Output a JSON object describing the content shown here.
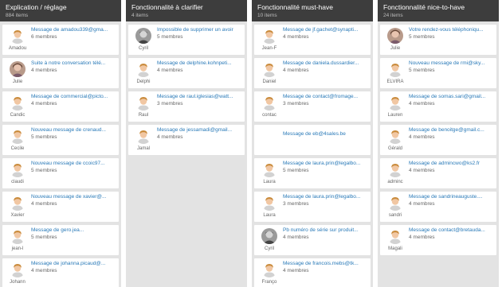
{
  "columns": [
    {
      "title": "Explication / réglage",
      "count": "884 items",
      "cards": [
        {
          "title": "Message de amadou339@gma...",
          "members": "6 membres",
          "user": "Amadou",
          "avatar": "default"
        },
        {
          "title": "Suite à notre conversation télé...",
          "members": "4 membres",
          "user": "Julie",
          "avatar": "photo"
        },
        {
          "title": "Message de commercial@picto...",
          "members": "4 membres",
          "user": "Candic",
          "avatar": "default"
        },
        {
          "title": "Nouveau message de crenaud...",
          "members": "5 membres",
          "user": "Cecile",
          "avatar": "default"
        },
        {
          "title": "Nouveau message de ccoic97...",
          "members": "5 membres",
          "user": "claudi",
          "avatar": "default"
        },
        {
          "title": "Nouveau message de xavier@...",
          "members": "4 membres",
          "user": "Xavier",
          "avatar": "default"
        },
        {
          "title": "Message de gero.jea...",
          "members": "5 membres",
          "user": "jean-l",
          "avatar": "default"
        },
        {
          "title": "Message de johanna.picaud@...",
          "members": "4 membres",
          "user": "Johann",
          "avatar": "default"
        }
      ]
    },
    {
      "title": "Fonctionnalité à clarifier",
      "count": "4 items",
      "cards": [
        {
          "title": "Impossible de supprimer un avoir",
          "members": "5 membres",
          "user": "Cyril",
          "avatar": "photo-grey"
        },
        {
          "title": "Message de delphine.kohnpeti...",
          "members": "4 membres",
          "user": "Delphi",
          "avatar": "default"
        },
        {
          "title": "Message de raul.iglesias@watt...",
          "members": "3 membres",
          "user": "Raul",
          "avatar": "default"
        },
        {
          "title": "Message de jessamadi@gmail...",
          "members": "4 membres",
          "user": "Jamal",
          "avatar": "default"
        }
      ]
    },
    {
      "title": "Fonctionnalité must-have",
      "count": "10 items",
      "cards": [
        {
          "title": "Message de jf.gachet@synapti...",
          "members": "4 membres",
          "user": "Jean-F",
          "avatar": "default"
        },
        {
          "title": "Message de daniela.dussardier...",
          "members": "4 membres",
          "user": "Daniel",
          "avatar": "default"
        },
        {
          "title": "Message de contact@fromage...",
          "members": "3 membres",
          "user": "contac",
          "avatar": "default"
        },
        {
          "title": "Message de eb@4sales.be",
          "members": "",
          "user": "",
          "avatar": "none"
        },
        {
          "title": "Message de laura.prin@legalbo...",
          "members": "5 membres",
          "user": "Laura",
          "avatar": "default"
        },
        {
          "title": "Message de laura.prin@legalbo...",
          "members": "3 membres",
          "user": "Laura",
          "avatar": "default"
        },
        {
          "title": "Pb numéro de série sur produit...",
          "members": "4 membres",
          "user": "Cyril",
          "avatar": "photo-grey"
        },
        {
          "title": "Message de francois.mebs@tk...",
          "members": "4 membres",
          "user": "Franço",
          "avatar": "default"
        }
      ]
    },
    {
      "title": "Fonctionnalité nice-to-have",
      "count": "24 items",
      "cards": [
        {
          "title": "Votre rendez-vous téléphoniqu...",
          "members": "5 membres",
          "user": "Julie",
          "avatar": "photo"
        },
        {
          "title": "Nouveau message de rmi@sky...",
          "members": "5 membres",
          "user": "ELVIRA",
          "avatar": "default"
        },
        {
          "title": "Message de somas.sari@gmail...",
          "members": "4 membres",
          "user": "Lauren",
          "avatar": "default"
        },
        {
          "title": "Message de benoitge@gmail.c...",
          "members": "4 membres",
          "user": "Gérald",
          "avatar": "default"
        },
        {
          "title": "Message de admincwo@ks2.fr",
          "members": "4 membres",
          "user": "adminc",
          "avatar": "default"
        },
        {
          "title": "Message de sandrineauguste....",
          "members": "4 membres",
          "user": "sandri",
          "avatar": "default"
        },
        {
          "title": "Message de contact@bretauda...",
          "members": "4 membres",
          "user": "Magali",
          "avatar": "default"
        }
      ]
    }
  ]
}
